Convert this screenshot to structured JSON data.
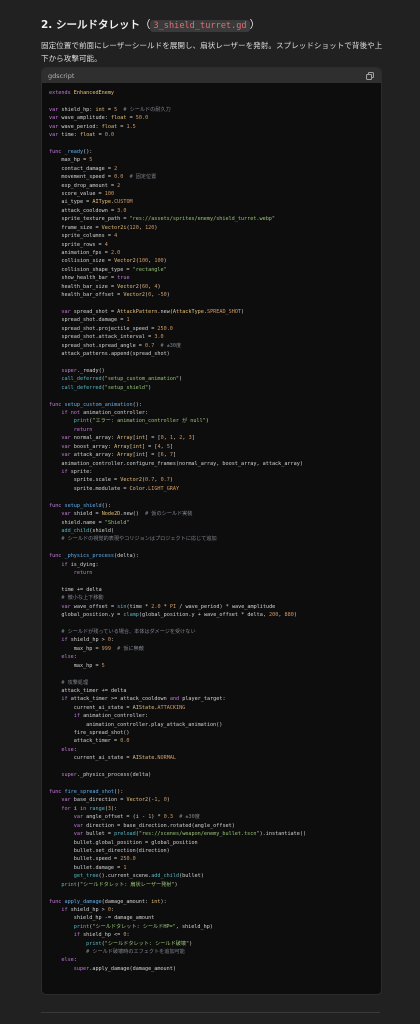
{
  "section": {
    "title": "2. シールドタレット",
    "paren_open": "（",
    "filename": "3_shield_turret.gd",
    "paren_close": "）",
    "description": "固定位置で前面にレーザーシールドを展開し、扇状レーザーを発射。スプレッドショットで背後や上下から攻撃可能。"
  },
  "code_block": {
    "language": "gdscript",
    "copy_icon": "copy-icon",
    "lines": [
      "extends EnhancedEnemy",
      "",
      "var shield_hp: int = 5  # シールドの耐久力",
      "var wave_amplitude: float = 50.0",
      "var wave_period: float = 1.5",
      "var time: float = 0.0",
      "",
      "func _ready():",
      "    max_hp = 5",
      "    contact_damage = 2",
      "    movement_speed = 0.0  # 固定位置",
      "    exp_drop_amount = 2",
      "    score_value = 100",
      "    ai_type = AIType.CUSTOM",
      "    attack_cooldown = 3.0",
      "    sprite_texture_path = \"res://assets/sprites/enemy/shield_turret.webp\"",
      "    frame_size = Vector2i(120, 120)",
      "    sprite_columns = 4",
      "    sprite_rows = 4",
      "    animation_fps = 2.0",
      "    collision_size = Vector2(100, 100)",
      "    collision_shape_type = \"rectangle\"",
      "    show_health_bar = true",
      "    health_bar_size = Vector2(60, 4)",
      "    health_bar_offset = Vector2(0, -50)",
      "",
      "    var spread_shot = AttackPattern.new(AttackType.SPREAD_SHOT)",
      "    spread_shot.damage = 1",
      "    spread_shot.projectile_speed = 250.0",
      "    spread_shot.attack_interval = 3.0",
      "    spread_shot.spread_angle = 0.7  # ±30度",
      "    attack_patterns.append(spread_shot)",
      "",
      "    super._ready()",
      "    call_deferred(\"setup_custom_animation\")",
      "    call_deferred(\"setup_shield\")",
      "",
      "func setup_custom_animation():",
      "    if not animation_controller:",
      "        print(\"エラー: animation_controller が null\")",
      "        return",
      "    var normal_array: Array[int] = [0, 1, 2, 3]",
      "    var boost_array: Array[int] = [4, 5]",
      "    var attack_array: Array[int] = [6, 7]",
      "    animation_controller.configure_frames(normal_array, boost_array, attack_array)",
      "    if sprite:",
      "        sprite.scale = Vector2(0.7, 0.7)",
      "        sprite.modulate = Color.LIGHT_GRAY",
      "",
      "func setup_shield():",
      "    var shield = Node2D.new()  # 仮のシールド実装",
      "    shield.name = \"Shield\"",
      "    add_child(shield)",
      "    # シールドの視覚的表現やコリジョンはプロジェクトに応じて追加",
      "",
      "func _physics_process(delta):",
      "    if is_dying:",
      "        return",
      "",
      "    time += delta",
      "    # 微小な上下移動",
      "    var wave_offset = sin(time * 2.0 * PI / wave_period) * wave_amplitude",
      "    global_position.y = clamp(global_position.y + wave_offset * delta, 200, 880)",
      "",
      "    # シールドが残っている場合、本体はダメージを受けない",
      "    if shield_hp > 0:",
      "        max_hp = 999  # 仮に無敵",
      "    else:",
      "        max_hp = 5",
      "",
      "    # 攻撃処理",
      "    attack_timer += delta",
      "    if attack_timer >= attack_cooldown and player_target:",
      "        current_ai_state = AIState.ATTACKING",
      "        if animation_controller:",
      "            animation_controller.play_attack_animation()",
      "        fire_spread_shot()",
      "        attack_timer = 0.0",
      "    else:",
      "        current_ai_state = AIState.NORMAL",
      "",
      "    super._physics_process(delta)",
      "",
      "func fire_spread_shot():",
      "    var base_direction = Vector2(-1, 0)",
      "    for i in range(3):",
      "        var angle_offset = (i - 1) * 0.3  # ±30度",
      "        var direction = base_direction.rotated(angle_offset)",
      "        var bullet = preload(\"res://scenes/weapon/enemy_bullet.tscn\").instantiate()",
      "        bullet.global_position = global_position",
      "        bullet.set_direction(direction)",
      "        bullet.speed = 250.0",
      "        bullet.damage = 1",
      "        get_tree().current_scene.add_child(bullet)",
      "    print(\"シールドタレット: 扇状レーザー発射\")",
      "",
      "func apply_damage(damage_amount: int):",
      "    if shield_hp > 0:",
      "        shield_hp -= damage_amount",
      "        print(\"シールドタレット: シールドHP=\", shield_hp)",
      "        if shield_hp <= 0:",
      "            print(\"シールドタレット: シールド破壊\")",
      "            # シールド破壊時のエフェクトを追加可能",
      "    else:",
      "        super.apply_damage(damage_amount)"
    ]
  },
  "colors": {
    "background": "#212121",
    "code_background": "#0d0d0d",
    "keyword": "#c678dd",
    "function": "#61afef",
    "string": "#98c379",
    "number": "#d19a66",
    "comment": "#7f848e",
    "type": "#e5c07b",
    "inline_code": "#e06c75"
  }
}
